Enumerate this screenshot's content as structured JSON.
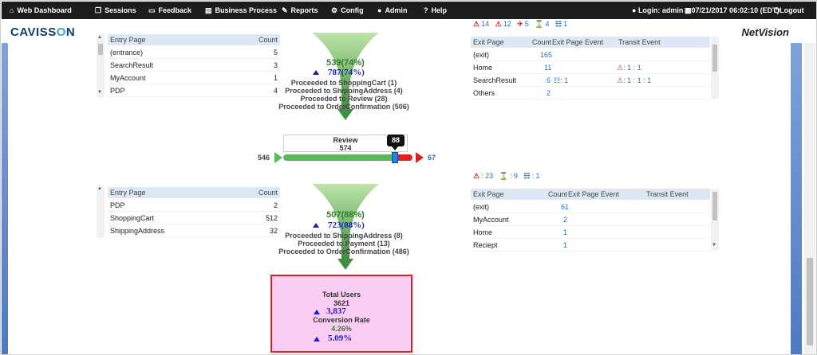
{
  "nav": {
    "items": [
      {
        "icon": "dashboard-icon",
        "glyph": "⌂",
        "label": "Web Dashboard"
      },
      {
        "icon": "sessions-icon",
        "glyph": "❐",
        "label": "Sessions"
      },
      {
        "icon": "feedback-icon",
        "glyph": "▭",
        "label": "Feedback"
      },
      {
        "icon": "business-process-icon",
        "glyph": "▤",
        "label": "Business Process"
      },
      {
        "icon": "reports-icon",
        "glyph": "✎",
        "label": "Reports"
      },
      {
        "icon": "config-icon",
        "glyph": "⚙",
        "label": "Config"
      },
      {
        "icon": "admin-icon",
        "glyph": "●",
        "label": "Admin"
      },
      {
        "icon": "help-icon",
        "glyph": "?",
        "label": "Help"
      }
    ],
    "login": "Login: admin",
    "datetime": "07/21/2017 06:02:10 (EDT)",
    "logout": "Logout"
  },
  "brand": {
    "left_a": "CAVISS",
    "left_b": "O",
    "left_c": "N",
    "right": "NetVision"
  },
  "top_entry": {
    "header": {
      "page": "Entry Page",
      "count": "Count"
    },
    "rows": [
      {
        "page": "(entrance)",
        "count": "5"
      },
      {
        "page": "SearchResult",
        "count": "3"
      },
      {
        "page": "MyAccount",
        "count": "1"
      },
      {
        "page": "PDP",
        "count": "4"
      }
    ]
  },
  "top_funnel": {
    "pct": "539(74%)",
    "blue": "787(74%)",
    "lines": [
      "Proceeded to ShoppingCart (1)",
      "Proceeded to ShippingAddress (4)",
      "Proceeded to Review (28)",
      "Proceeded to OrderConfirmation (506)"
    ]
  },
  "top_exit": {
    "icons": [
      {
        "icon": "error-icon",
        "value": "14"
      },
      {
        "icon": "warning-icon",
        "value": "12"
      },
      {
        "icon": "plane-icon",
        "value": "5"
      },
      {
        "icon": "hourglass-icon",
        "value": "4"
      },
      {
        "icon": "page-icon",
        "value": "1"
      }
    ],
    "header": {
      "page": "Exit Page",
      "count": "Count",
      "event": "Exit Page Event",
      "transit": "Transit Event"
    },
    "rows": [
      {
        "page": "(exit)",
        "count": "165",
        "event": "",
        "transit": ""
      },
      {
        "page": "Home",
        "count": "11",
        "event": "",
        "transit": ": 1  : 1"
      },
      {
        "page": "SearchResult",
        "count": "6",
        "event": ": 1",
        "transit": ": 1  : 1  : 1"
      },
      {
        "page": "Others",
        "count": "2",
        "event": "",
        "transit": ""
      }
    ]
  },
  "review": {
    "title": "Review",
    "count": "574",
    "tooltip": "88",
    "in": "546",
    "out": "67",
    "fill": 0.86
  },
  "bottom_entry": {
    "header": {
      "page": "Entry Page",
      "count": "Count"
    },
    "rows": [
      {
        "page": "PDP",
        "count": "2"
      },
      {
        "page": "ShoppingCart",
        "count": "512"
      },
      {
        "page": "ShippingAddress",
        "count": "32"
      }
    ]
  },
  "bottom_funnel": {
    "pct": "507(88%)",
    "blue": "723(88%)",
    "lines": [
      "Proceeded to ShippingAddress (8)",
      "Proceeded to Payment (13)",
      "Proceeded to OrderConfirmation (486)"
    ]
  },
  "bottom_exit": {
    "icons": [
      {
        "icon": "warning-icon",
        "value": "23"
      },
      {
        "icon": "hourglass-icon",
        "value": "9"
      },
      {
        "icon": "page-icon",
        "value": "1"
      }
    ],
    "header": {
      "page": "Exit Page",
      "count": "Count",
      "event": "Exit Page Event",
      "transit": "Transit Event"
    },
    "rows": [
      {
        "page": "(exit)",
        "count": "61"
      },
      {
        "page": "MyAccount",
        "count": "2"
      },
      {
        "page": "Home",
        "count": "1"
      },
      {
        "page": "Reciept",
        "count": "1"
      }
    ]
  },
  "summary": {
    "total_label": "Total Users",
    "total_value": "3621",
    "total_blue": "3,837",
    "conv_label": "Conversion Rate",
    "conv_value": "4.26%",
    "conv_blue": "5.09%"
  }
}
